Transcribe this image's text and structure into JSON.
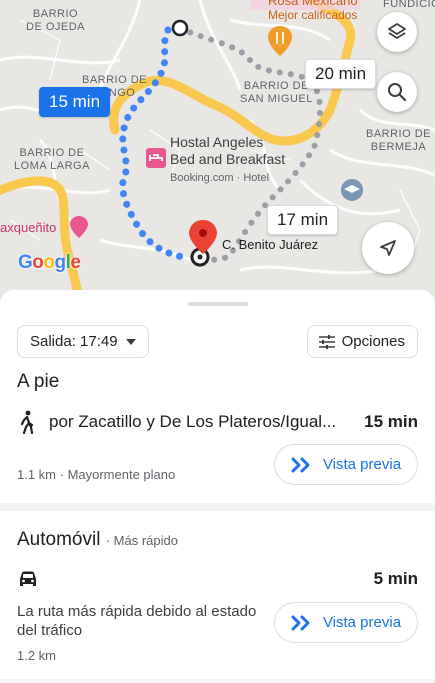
{
  "map": {
    "labels": {
      "barrio_ojeda": "BARRIO\nDE OJEDA",
      "barrio_tengo": "BARRIO DE\nTENGO",
      "barrio_san_miguel": "BARRIO DE\nSAN MIGUEL",
      "barrio_loma_larga": "BARRIO DE\nLOMA LARGA",
      "barrio_bermeja": "BARRIO DE\nBERMEJA",
      "fundicion": "FUNDICIÓN"
    },
    "rosa_mexicano": "Rosa Mexicano",
    "mejor_calificados": "Mejor calificados",
    "hotel_name": "Hostal Angeles\nBed and Breakfast",
    "hotel_sub": "Booking.com · Hotel",
    "axquenito": "axqueñito",
    "destination": "C. Benito Juárez",
    "durations": {
      "walk": "15 min",
      "alt1": "20 min",
      "alt2": "17 min"
    },
    "google_logo": "Google"
  },
  "sheet": {
    "depart_label": "Salida: 17:49",
    "options_label": "Opciones",
    "walk": {
      "title": "A pie",
      "via": "por Zacatillo y De Los Plateros/Igual...",
      "time": "15 min",
      "meta": "1.1 km · Mayormente plano",
      "preview": "Vista previa"
    },
    "drive": {
      "title": "Automóvil",
      "badge": "· Más rápido",
      "time": "5 min",
      "desc": "La ruta más rápida debido al estado del tráfico",
      "meta": "1.2 km",
      "preview": "Vista previa"
    }
  },
  "colors": {
    "accent": "#1a73e8",
    "route_dots": "#4285f4",
    "alt_dots": "#9aa0a6",
    "road": "#f9c84f",
    "pin": "#ea4335"
  }
}
